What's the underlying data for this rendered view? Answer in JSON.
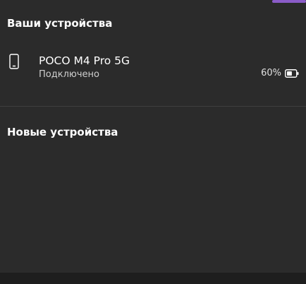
{
  "sections": {
    "your_devices_title": "Ваши устройства",
    "new_devices_title": "Новые устройства"
  },
  "device": {
    "name": "POCO M4 Pro 5G",
    "status": "Подключено",
    "battery_percent": 60,
    "battery_label": "60%",
    "icon": "phone-icon"
  },
  "colors": {
    "accent": "#8b5cc8",
    "panel": "#2b2b2b"
  }
}
